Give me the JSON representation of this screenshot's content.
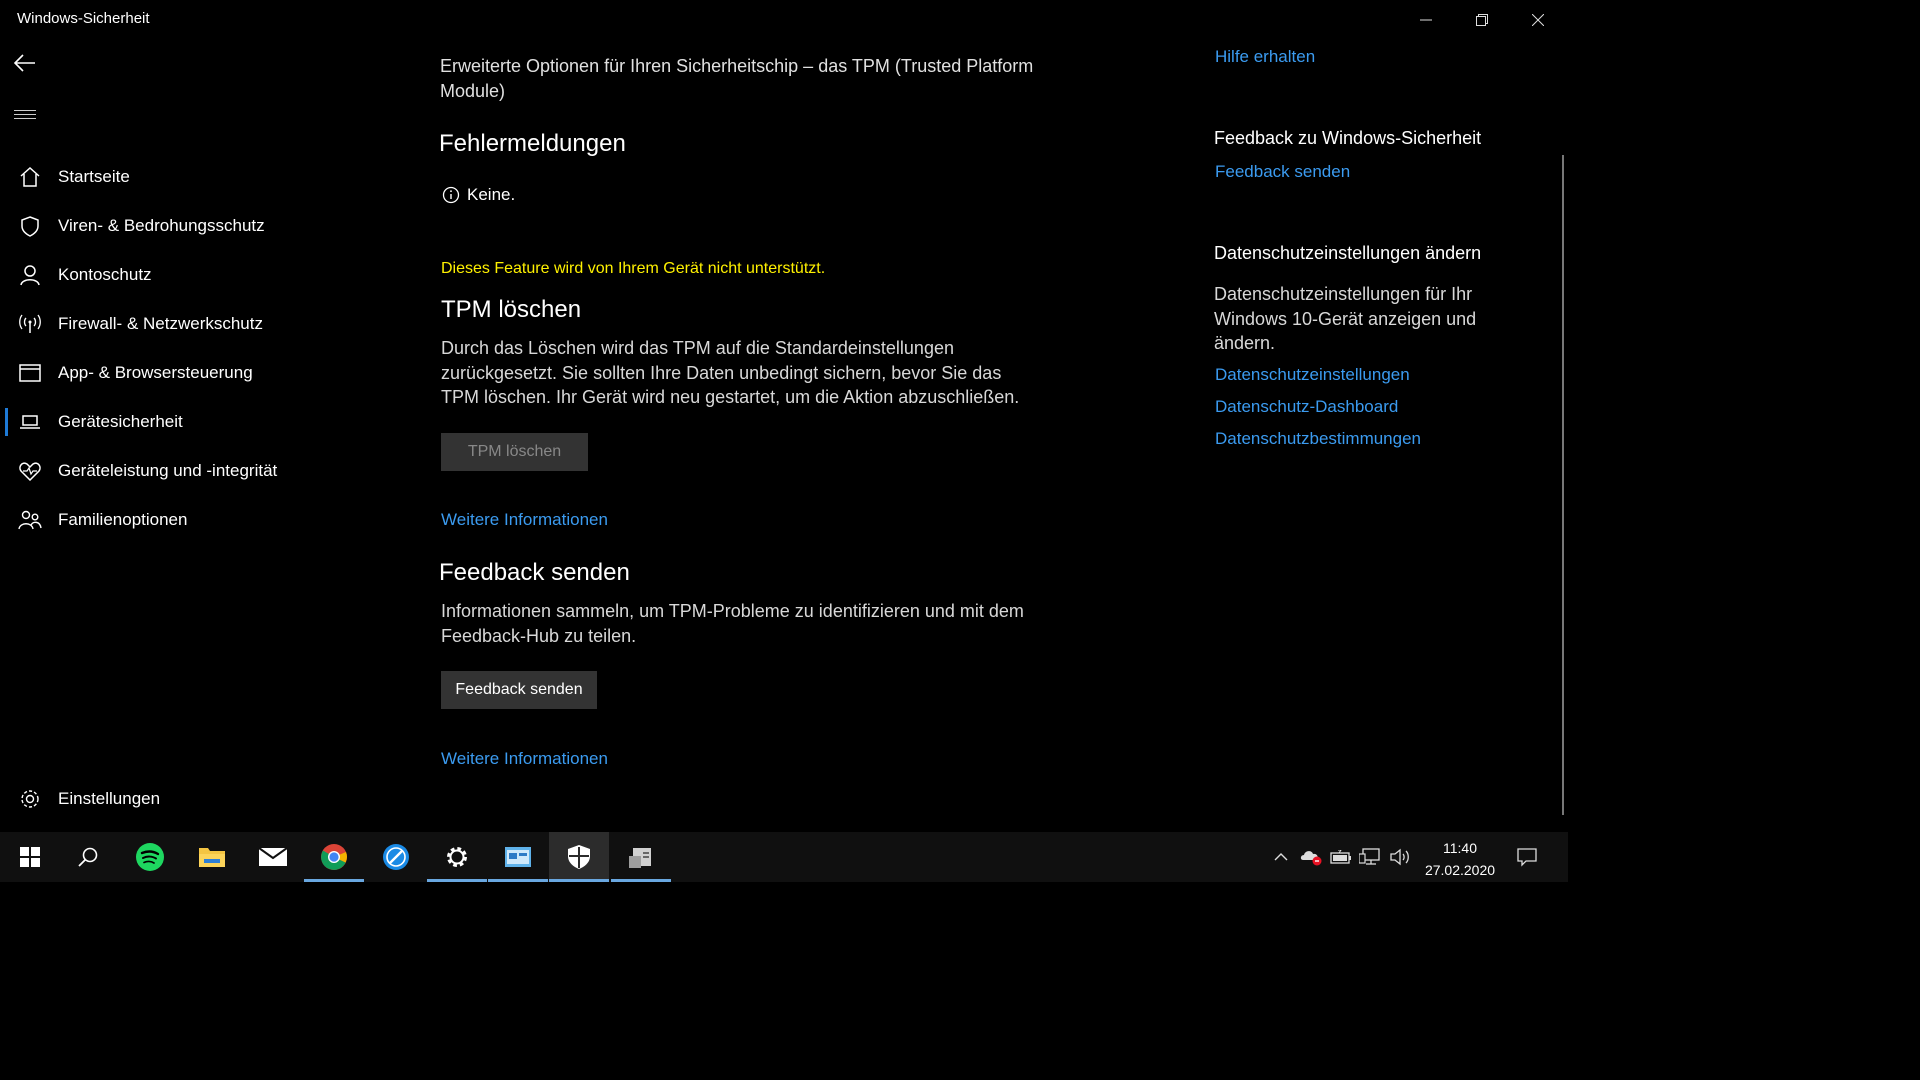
{
  "window": {
    "title": "Windows-Sicherheit",
    "minimize_label": "—",
    "restore_label": "❐",
    "close_label": "✕"
  },
  "sidebar": {
    "items": [
      {
        "label": "Startseite",
        "icon": "home-icon"
      },
      {
        "label": "Viren- & Bedrohungsschutz",
        "icon": "shield-icon"
      },
      {
        "label": "Kontoschutz",
        "icon": "person-icon"
      },
      {
        "label": "Firewall- & Netzwerkschutz",
        "icon": "antenna-icon"
      },
      {
        "label": "App- & Browsersteuerung",
        "icon": "app-window-icon"
      },
      {
        "label": "Gerätesicherheit",
        "icon": "laptop-icon",
        "selected": true
      },
      {
        "label": "Geräteleistung und -integrität",
        "icon": "heart-icon"
      },
      {
        "label": "Familienoptionen",
        "icon": "family-icon"
      }
    ],
    "settings_label": "Einstellungen"
  },
  "main": {
    "intro": "Erweiterte Optionen für Ihren Sicherheitschip – das TPM (Trusted Platform Module)",
    "errors_title": "Fehlermeldungen",
    "errors_value": "Keine.",
    "unsupported_warning": "Dieses Feature wird von Ihrem Gerät nicht unterstützt.",
    "tpm_clear": {
      "title": "TPM löschen",
      "description": "Durch das Löschen wird das TPM auf die Standardeinstellungen zurückgesetzt. Sie sollten Ihre Daten unbedingt sichern, bevor Sie das TPM löschen. Ihr Gerät wird neu gestartet, um die Aktion abzuschließen.",
      "button": "TPM löschen",
      "more_info": "Weitere Informationen"
    },
    "feedback": {
      "title": "Feedback senden",
      "description": "Informationen sammeln, um TPM-Probleme zu identifizieren und mit dem Feedback-Hub zu teilen.",
      "button": "Feedback senden",
      "more_info": "Weitere Informationen"
    }
  },
  "right": {
    "help_link": "Hilfe erhalten",
    "feedback_title": "Feedback zu Windows-Sicherheit",
    "feedback_link": "Feedback senden",
    "privacy_title": "Datenschutzeinstellungen ändern",
    "privacy_text": "Datenschutzeinstellungen für Ihr Windows 10-Gerät anzeigen und ändern.",
    "privacy_links": [
      "Datenschutzeinstellungen",
      "Datenschutz-Dashboard",
      "Datenschutzbestimmungen"
    ]
  },
  "taskbar": {
    "apps": [
      {
        "icon": "start-icon"
      },
      {
        "icon": "search-icon"
      },
      {
        "icon": "spotify-icon"
      },
      {
        "icon": "file-explorer-icon"
      },
      {
        "icon": "mail-icon"
      },
      {
        "icon": "chrome-icon",
        "running": true
      },
      {
        "icon": "remote-app-icon"
      },
      {
        "icon": "settings-gear-icon",
        "running": true
      },
      {
        "icon": "control-panel-icon",
        "running": true
      },
      {
        "icon": "windows-security-icon",
        "running": true,
        "active": true
      },
      {
        "icon": "device-app-icon",
        "running": true
      }
    ],
    "time": "11:40",
    "date": "27.02.2020"
  },
  "colors": {
    "accent": "#1e7ad6",
    "link": "#3b9bf0",
    "warning": "#fff100",
    "taskbar": "#101010"
  }
}
